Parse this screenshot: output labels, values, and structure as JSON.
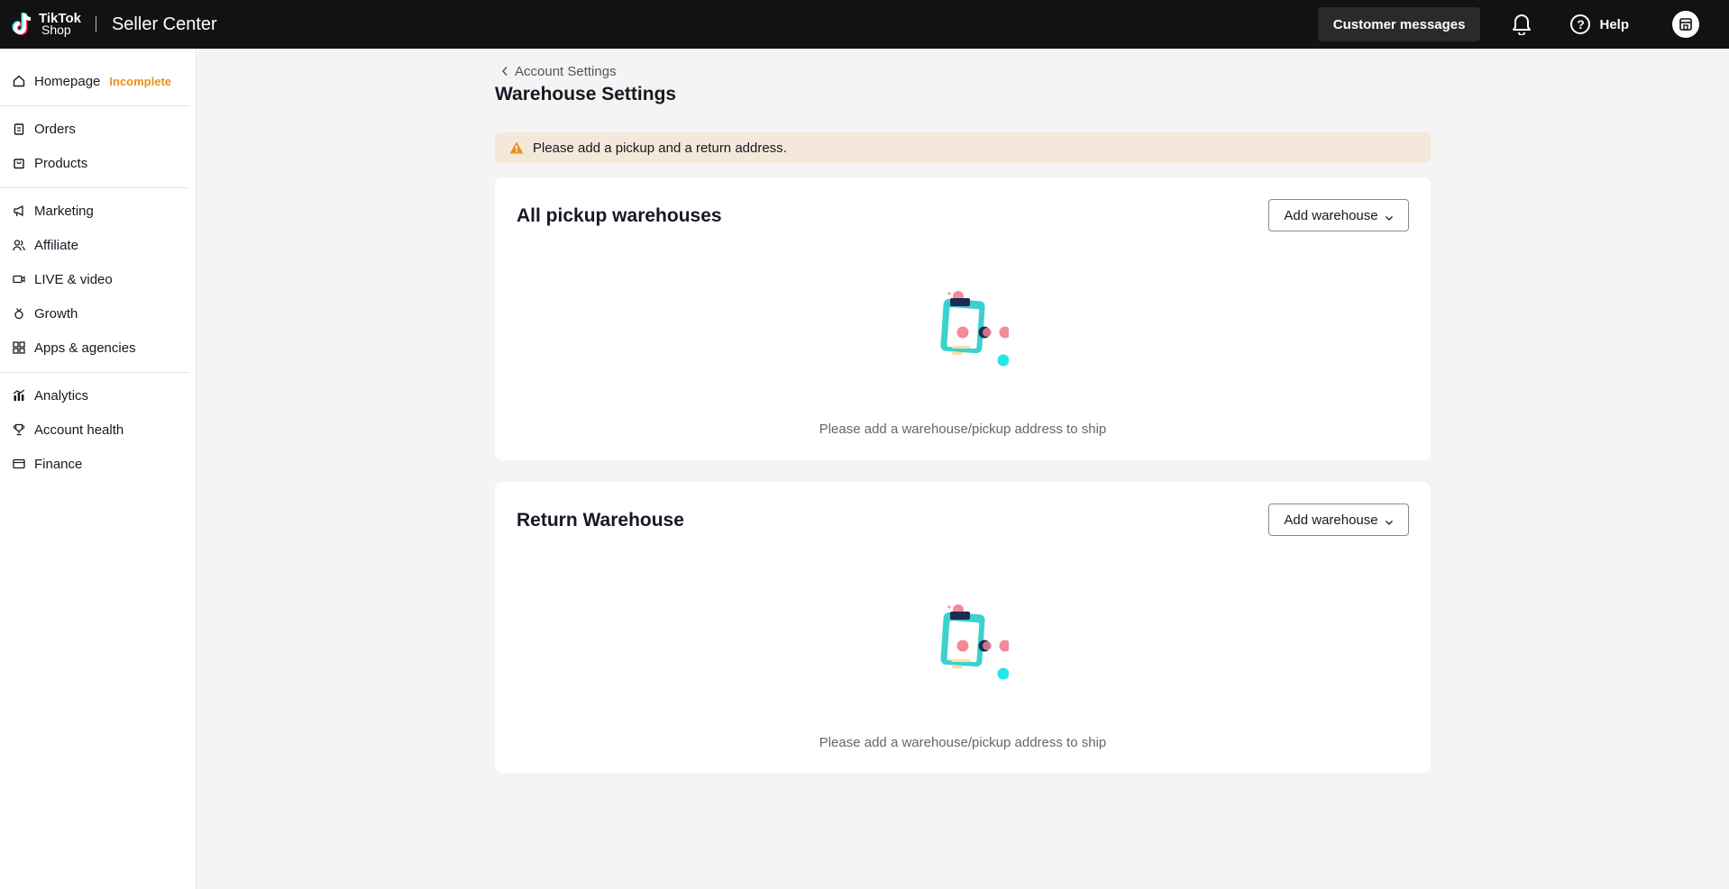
{
  "header": {
    "logo_line1": "TikTok",
    "logo_line2": "Shop",
    "app_title": "Seller Center",
    "customer_messages_label": "Customer messages",
    "help_label": "Help"
  },
  "sidebar": {
    "items": [
      {
        "label": "Homepage",
        "badge": "Incomplete",
        "icon": "home-icon"
      },
      {
        "label": "Orders",
        "icon": "clipboard-icon"
      },
      {
        "label": "Products",
        "icon": "bag-icon"
      },
      {
        "label": "Marketing",
        "icon": "megaphone-icon"
      },
      {
        "label": "Affiliate",
        "icon": "people-icon"
      },
      {
        "label": "LIVE & video",
        "icon": "video-icon"
      },
      {
        "label": "Growth",
        "icon": "medal-icon"
      },
      {
        "label": "Apps & agencies",
        "icon": "apps-icon"
      },
      {
        "label": "Analytics",
        "icon": "chart-icon"
      },
      {
        "label": "Account health",
        "icon": "trophy-icon"
      },
      {
        "label": "Finance",
        "icon": "wallet-icon"
      }
    ]
  },
  "main": {
    "breadcrumb": "Account Settings",
    "page_title": "Warehouse Settings",
    "alert_text": "Please add a pickup and a return address.",
    "sections": [
      {
        "title": "All pickup warehouses",
        "button_label": "Add warehouse",
        "empty_text": "Please add a warehouse/pickup address to ship"
      },
      {
        "title": "Return Warehouse",
        "button_label": "Add warehouse",
        "empty_text": "Please add a warehouse/pickup address to ship"
      }
    ]
  },
  "colors": {
    "topbar": "#121212",
    "alert_bg": "#f4e8da",
    "warning": "#e9901e",
    "illustration_teal": "#3bd1cf",
    "illustration_pink": "#f58a96",
    "illustration_navy": "#1e2a52"
  }
}
